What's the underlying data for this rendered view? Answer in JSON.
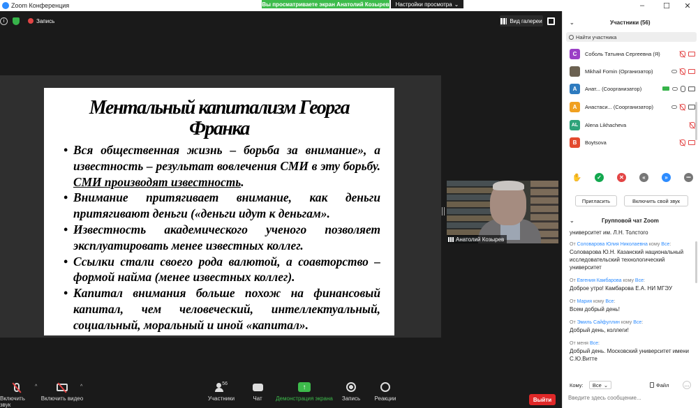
{
  "window": {
    "title": "Zoom Конференция",
    "sharing_banner": "Вы просматриваете экран Анатолий Козырев",
    "view_options": "Настройки просмотра",
    "minimize": "–",
    "maximize": "☐",
    "close": "✕"
  },
  "meeting_top": {
    "recording_label": "Запись",
    "gallery_label": "Вид галереи"
  },
  "slide": {
    "title": "Ментальный капитализм Георга Франка",
    "bullets": [
      {
        "text": "Вся общественная жизнь – борьба за внимание», а известность – результат вовлечения СМИ в эту борьбу. ",
        "underlined": "СМИ производят известность",
        "tail": "."
      },
      {
        "text": "Внимание притягивает внимание, как деньги притягивают деньги («деньги идут к деньгам»."
      },
      {
        "text": "Известность академического ученого позволяет эксплуатировать менее известных коллег."
      },
      {
        "text": "Ссылки стали своего рода валютой, а соавторство – формой найма (менее известных коллег)."
      },
      {
        "text": "Капитал внимания больше похож на финансовый капитал, чем человеческий, интеллектуальный, социальный, моральный и иной «капитал»."
      }
    ]
  },
  "video": {
    "name": "Анатолий Козырев"
  },
  "toolbar": {
    "mute_label": "Включить звук",
    "video_label": "Включить видео",
    "participants_label": "Участники",
    "participants_count": "56",
    "chat_label": "Чат",
    "share_label": "Демонстрация экрана",
    "record_label": "Запись",
    "reactions_label": "Реакции",
    "leave_label": "Выйти"
  },
  "panel": {
    "participants_title": "Участники (56)",
    "search_placeholder": "Найти участника",
    "participants": [
      {
        "initial": "С",
        "color": "#9b3fc6",
        "name": "Соболь Татьяна Сергеевна (Я)"
      },
      {
        "initial": "",
        "color": "#6b6151",
        "name": "Mikhail Fomin (Организатор)"
      },
      {
        "initial": "А",
        "color": "#2e7bbf",
        "name": "Анат...  (Соорганизатор)"
      },
      {
        "initial": "А",
        "color": "#f0a020",
        "name": "Анастаси... (Соорганизатор)"
      },
      {
        "initial": "AL",
        "color": "#2ea37a",
        "name": "Alena Likhacheva"
      },
      {
        "initial": "B",
        "color": "#e34a2f",
        "name": "Boytsova"
      }
    ],
    "invite_label": "Пригласить",
    "unmute_label": "Включить свой звук",
    "reactions": [
      {
        "icon": "✋",
        "color": "#2d8cff"
      },
      {
        "icon": "✓",
        "color": "#13a84f"
      },
      {
        "icon": "✕",
        "color": "#e34545"
      },
      {
        "icon": "«",
        "color": "#777777"
      },
      {
        "icon": "»",
        "color": "#2d8cff"
      },
      {
        "icon": "•••",
        "color": "#777777"
      }
    ]
  },
  "chat": {
    "title": "Групповой чат Zoom",
    "partial_top": "университет им. Л.Н. Толстого",
    "messages": [
      {
        "from": "Соловарова Юлия Николаевна",
        "to": "Все",
        "text": "Соловарова Ю.Н. Казанский национальный исследовательский технологический университет"
      },
      {
        "from": "Евгения Камбарова",
        "to": "Все",
        "text": "Доброе утро! Камбарова Е.А. НИ МГЭУ"
      },
      {
        "from": "Мария",
        "to": "Все",
        "text": "Всем добрый день!"
      },
      {
        "from": "Эмиль Сайфуллин",
        "to": "Все",
        "text": "Добрый день, коллеги!"
      },
      {
        "from": "меня",
        "to": "Все",
        "text": "Добрый день. Московский университет имени С.Ю.Витте"
      }
    ],
    "from_word": "От",
    "to_word": "кому",
    "to_label": "Кому:",
    "to_value": "Все",
    "file_label": "Файл",
    "input_placeholder": "Введите здесь сообщение..."
  }
}
